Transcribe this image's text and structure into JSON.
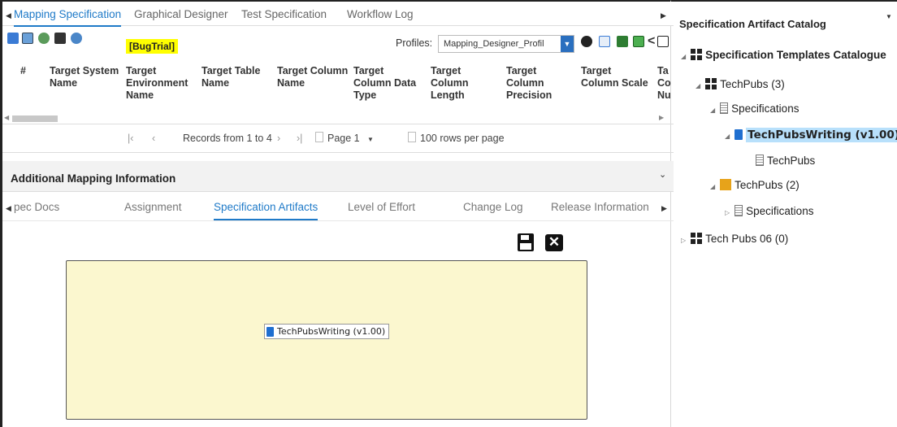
{
  "tabs": [
    "Mapping Specification",
    "Graphical Designer",
    "Test Specification",
    "Workflow Log"
  ],
  "toolbar": {
    "bug_tag": "[BugTrial]",
    "profiles_label": "Profiles:",
    "profile_value": "Mapping_Designer_Profil"
  },
  "grid": {
    "headers": [
      "#",
      "Target System Name",
      "Target Environment Name",
      "Target Table Name",
      "Target Column Name",
      "Target Column Data Type",
      "Target Column Length",
      "Target Column Precision",
      "Target Column Scale",
      "Ta Co Nu"
    ]
  },
  "pager": {
    "records": "Records from 1 to 4",
    "page": "Page 1",
    "rows": "100 rows per page"
  },
  "section": {
    "title": "Additional Mapping Information"
  },
  "subtabs": [
    "pec Docs",
    "Assignment",
    "Specification Artifacts",
    "Level of Effort",
    "Change Log",
    "Release Information"
  ],
  "artifact": {
    "chip": "TechPubsWriting (v1.00)"
  },
  "catalog": {
    "title": "Specification Artifact Catalog",
    "root": "Specification Templates Catalogue",
    "n1": "TechPubs (3)",
    "n1a": "Specifications",
    "n1a1": "TechPubsWriting (v1.00)",
    "n1a1a": "TechPubs",
    "n2": "TechPubs (2)",
    "n2a": "Specifications",
    "n3": "Tech Pubs 06 (0)"
  }
}
